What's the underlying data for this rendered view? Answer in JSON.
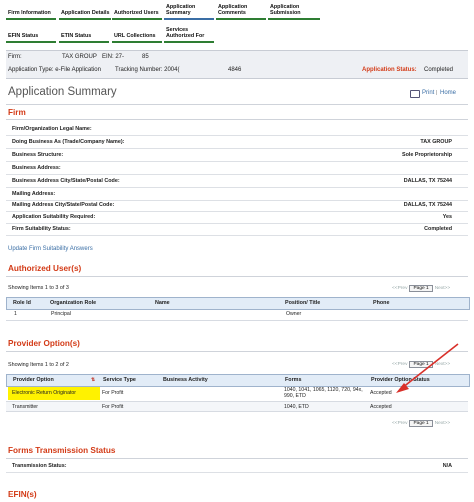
{
  "nav": {
    "row1": [
      {
        "label": "Firm Information",
        "blue": false
      },
      {
        "label": "Application Details",
        "blue": false
      },
      {
        "label": "Authorized Users",
        "blue": false
      },
      {
        "label": "Application\nSummary",
        "blue": true
      },
      {
        "label": "Application\nComments",
        "blue": false
      },
      {
        "label": "Application\nSubmission",
        "blue": false
      }
    ],
    "row2": [
      {
        "label": "EFIN Status"
      },
      {
        "label": "ETIN Status"
      },
      {
        "label": "URL Collections"
      },
      {
        "label": "Services\nAuthorized For"
      }
    ]
  },
  "firm": {
    "firm_label": "Firm:",
    "firm_name": "TAX GROUP",
    "ein_label": "EIN: 27-",
    "ein_tail": "85",
    "app_type": "Application Type: e-File Application",
    "tracking_label": "Tracking Number: 2004(",
    "tracking_tail": "4846",
    "status_label": "Application Status:",
    "status_value": "Completed"
  },
  "page": {
    "title": "Application Summary",
    "print": "Print",
    "home": "Home",
    "divider": "|"
  },
  "firm_section": {
    "heading": "Firm",
    "rows": [
      {
        "label": "Firm/Organization Legal Name:",
        "value": ""
      },
      {
        "label": "Doing Business As (Trade/Company Name):",
        "value": "TAX GROUP"
      },
      {
        "label": "Business Structure:",
        "value": "Sole Proprietorship"
      },
      {
        "label": "Business Address:",
        "value": ""
      },
      {
        "label": "Business Address City/State/Postal Code:",
        "value": "DALLAS, TX 75244"
      },
      {
        "label": "Mailing Address:",
        "value": ""
      },
      {
        "label": "Mailing Address City/State/Postal Code:",
        "value": "DALLAS, TX 75244"
      },
      {
        "label": "Application Suitability Required:",
        "value": "Yes"
      },
      {
        "label": "Firm Suitability Status:",
        "value": "Completed"
      }
    ],
    "update_link": "Update Firm Suitability Answers"
  },
  "auth_users": {
    "heading": "Authorized User(s)",
    "showing": "Showing Items 1 to 3 of 3",
    "pager": {
      "prev": "<<Prev",
      "page": "Page 1",
      "next": "Next>>"
    },
    "headers": [
      "Role Id",
      "Organization Role",
      "Name",
      "Position/ Title",
      "Phone"
    ],
    "rows": [
      [
        "1",
        "Principal",
        "",
        "Owner",
        ""
      ]
    ]
  },
  "providers": {
    "heading": "Provider Option(s)",
    "showing": "Showing Items 1 to 2 of 2",
    "pager": {
      "prev": "<<Prev",
      "page": "Page 1",
      "next": "Next>>"
    },
    "headers": [
      "Provider Option",
      "Service Type",
      "Business Activity",
      "Forms",
      "Provider Option Status"
    ],
    "rows": [
      [
        "Electronic Return Originator",
        "For Profit",
        "",
        "1040, 1041, 1065, 1120, 720, 94x, 990, ETD",
        "Accepted"
      ],
      [
        "Transmitter",
        "For Profit",
        "",
        "1040, ETD",
        "Accepted"
      ]
    ],
    "highlight_color": "#fff200",
    "arrow_color": "#d9302a"
  },
  "forms_tx": {
    "heading": "Forms Transmission Status",
    "row_label": "Transmission Status:",
    "row_value": "N/A"
  },
  "efin": {
    "heading": "EFIN(s)"
  }
}
